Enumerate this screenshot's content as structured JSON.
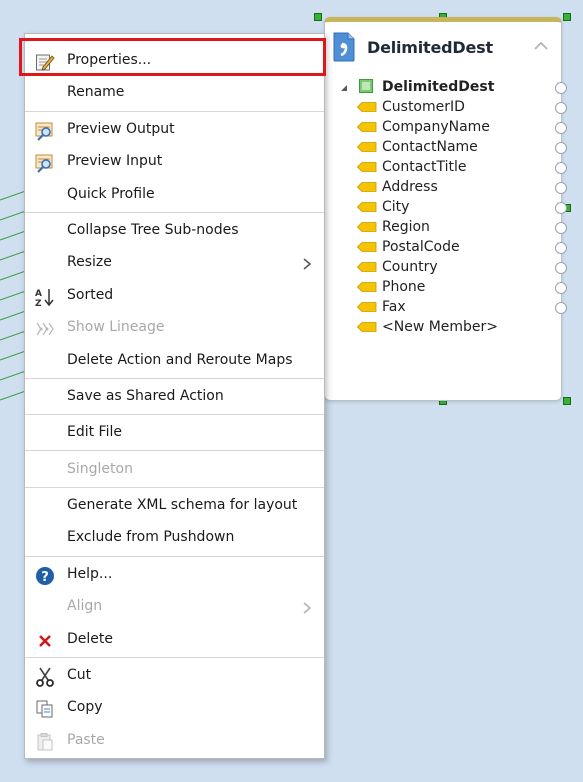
{
  "node": {
    "title": "DelimitedDest",
    "root_label": "DelimitedDest",
    "fields": [
      "CustomerID",
      "CompanyName",
      "ContactName",
      "ContactTitle",
      "Address",
      "City",
      "Region",
      "PostalCode",
      "Country",
      "Phone",
      "Fax",
      "<New Member>"
    ],
    "icons": {
      "file": "delimited-file-icon",
      "collapse": "chevron-up-icon",
      "root": "record-icon",
      "field": "field-tag-icon"
    },
    "colors": {
      "header_bar": "#c8b45a",
      "field_tag": "#f5c400",
      "selection_handle": "#36b336"
    }
  },
  "menu": {
    "items": [
      {
        "label": "Properties...",
        "icon": "properties-icon",
        "enabled": true
      },
      {
        "label": "Rename",
        "icon": "",
        "enabled": true
      },
      {
        "label": "Preview Output",
        "icon": "preview-icon",
        "enabled": true
      },
      {
        "label": "Preview Input",
        "icon": "preview-icon",
        "enabled": true
      },
      {
        "label": "Quick Profile",
        "icon": "",
        "enabled": true
      },
      {
        "label": "Collapse Tree Sub-nodes",
        "icon": "",
        "enabled": true
      },
      {
        "label": "Resize",
        "icon": "",
        "enabled": true,
        "submenu": true
      },
      {
        "label": "Sorted",
        "icon": "sort-az-icon",
        "enabled": true
      },
      {
        "label": "Show Lineage",
        "icon": "lineage-icon",
        "enabled": false
      },
      {
        "label": "Delete Action and Reroute Maps",
        "icon": "",
        "enabled": true
      },
      {
        "label": "Save as Shared Action",
        "icon": "",
        "enabled": true
      },
      {
        "label": "Edit File",
        "icon": "",
        "enabled": true
      },
      {
        "label": "Singleton",
        "icon": "",
        "enabled": false
      },
      {
        "label": "Generate XML schema for layout",
        "icon": "",
        "enabled": true
      },
      {
        "label": "Exclude from Pushdown",
        "icon": "",
        "enabled": true
      },
      {
        "label": "Help...",
        "icon": "help-icon",
        "enabled": true
      },
      {
        "label": "Align",
        "icon": "",
        "enabled": false,
        "submenu": true
      },
      {
        "label": "Delete",
        "icon": "delete-icon",
        "enabled": true
      },
      {
        "label": "Cut",
        "icon": "scissors-icon",
        "enabled": true
      },
      {
        "label": "Copy",
        "icon": "copy-icon",
        "enabled": true
      },
      {
        "label": "Paste",
        "icon": "paste-icon",
        "enabled": false
      }
    ],
    "highlighted_item": "Properties...",
    "colors": {
      "highlight_border": "#e0161d",
      "disabled_text": "#a8a8a8",
      "help_icon": "#1f5fa8",
      "delete_icon": "#d0191b"
    }
  }
}
